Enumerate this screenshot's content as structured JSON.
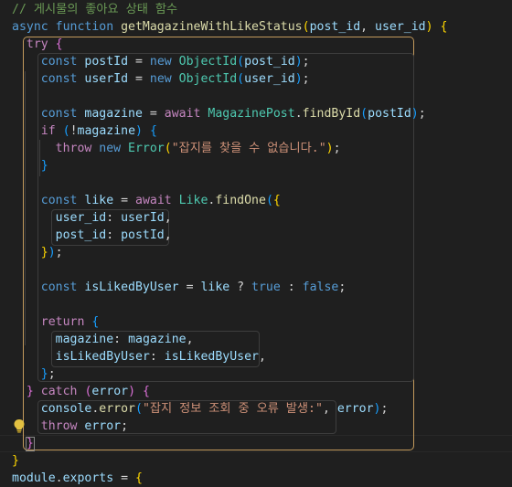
{
  "editor": {
    "lightbulb_icon": "lightbulb-icon",
    "lines": [
      {
        "n": 0,
        "tokens": [
          {
            "t": "// 게시물의 좋아요 상태 함수",
            "c": "cmt"
          }
        ]
      },
      {
        "n": 1,
        "tokens": [
          {
            "t": "async ",
            "c": "kw"
          },
          {
            "t": "function ",
            "c": "kw"
          },
          {
            "t": "getMagazineWithLikeStatus",
            "c": "fn"
          },
          {
            "t": "(",
            "c": "b1"
          },
          {
            "t": "post_id",
            "c": "var"
          },
          {
            "t": ", ",
            "c": "plain"
          },
          {
            "t": "user_id",
            "c": "var"
          },
          {
            "t": ")",
            "c": "b1"
          },
          {
            "t": " ",
            "c": "plain"
          },
          {
            "t": "{",
            "c": "b1"
          }
        ]
      },
      {
        "n": 2,
        "tokens": [
          {
            "t": "  ",
            "c": "plain"
          },
          {
            "t": "try",
            "c": "ctl"
          },
          {
            "t": " ",
            "c": "plain"
          },
          {
            "t": "{",
            "c": "b2"
          }
        ]
      },
      {
        "n": 3,
        "tokens": [
          {
            "t": "    ",
            "c": "plain"
          },
          {
            "t": "const ",
            "c": "kw"
          },
          {
            "t": "postId",
            "c": "var"
          },
          {
            "t": " = ",
            "c": "plain"
          },
          {
            "t": "new ",
            "c": "kw"
          },
          {
            "t": "ObjectId",
            "c": "cls"
          },
          {
            "t": "(",
            "c": "b3"
          },
          {
            "t": "post_id",
            "c": "var"
          },
          {
            "t": ")",
            "c": "b3"
          },
          {
            "t": ";",
            "c": "plain"
          }
        ]
      },
      {
        "n": 4,
        "tokens": [
          {
            "t": "    ",
            "c": "plain"
          },
          {
            "t": "const ",
            "c": "kw"
          },
          {
            "t": "userId",
            "c": "var"
          },
          {
            "t": " = ",
            "c": "plain"
          },
          {
            "t": "new ",
            "c": "kw"
          },
          {
            "t": "ObjectId",
            "c": "cls"
          },
          {
            "t": "(",
            "c": "b3"
          },
          {
            "t": "user_id",
            "c": "var"
          },
          {
            "t": ")",
            "c": "b3"
          },
          {
            "t": ";",
            "c": "plain"
          }
        ]
      },
      {
        "n": 5,
        "tokens": []
      },
      {
        "n": 6,
        "tokens": [
          {
            "t": "    ",
            "c": "plain"
          },
          {
            "t": "const ",
            "c": "kw"
          },
          {
            "t": "magazine",
            "c": "var"
          },
          {
            "t": " = ",
            "c": "plain"
          },
          {
            "t": "await ",
            "c": "ctl"
          },
          {
            "t": "MagazinePost",
            "c": "cls"
          },
          {
            "t": ".",
            "c": "plain"
          },
          {
            "t": "findById",
            "c": "fn"
          },
          {
            "t": "(",
            "c": "b3"
          },
          {
            "t": "postId",
            "c": "var"
          },
          {
            "t": ")",
            "c": "b3"
          },
          {
            "t": ";",
            "c": "plain"
          }
        ]
      },
      {
        "n": 7,
        "tokens": [
          {
            "t": "    ",
            "c": "plain"
          },
          {
            "t": "if",
            "c": "ctl"
          },
          {
            "t": " ",
            "c": "plain"
          },
          {
            "t": "(",
            "c": "b3"
          },
          {
            "t": "!",
            "c": "plain"
          },
          {
            "t": "magazine",
            "c": "var"
          },
          {
            "t": ")",
            "c": "b3"
          },
          {
            "t": " ",
            "c": "plain"
          },
          {
            "t": "{",
            "c": "b3"
          }
        ]
      },
      {
        "n": 8,
        "tokens": [
          {
            "t": "      ",
            "c": "plain"
          },
          {
            "t": "throw ",
            "c": "ctl"
          },
          {
            "t": "new ",
            "c": "kw"
          },
          {
            "t": "Error",
            "c": "cls"
          },
          {
            "t": "(",
            "c": "b1"
          },
          {
            "t": "\"잡지를 찾을 수 없습니다.\"",
            "c": "str"
          },
          {
            "t": ")",
            "c": "b1"
          },
          {
            "t": ";",
            "c": "plain"
          }
        ]
      },
      {
        "n": 9,
        "tokens": [
          {
            "t": "    ",
            "c": "plain"
          },
          {
            "t": "}",
            "c": "b3"
          }
        ]
      },
      {
        "n": 10,
        "tokens": []
      },
      {
        "n": 11,
        "tokens": [
          {
            "t": "    ",
            "c": "plain"
          },
          {
            "t": "const ",
            "c": "kw"
          },
          {
            "t": "like",
            "c": "var"
          },
          {
            "t": " = ",
            "c": "plain"
          },
          {
            "t": "await ",
            "c": "ctl"
          },
          {
            "t": "Like",
            "c": "cls"
          },
          {
            "t": ".",
            "c": "plain"
          },
          {
            "t": "findOne",
            "c": "fn"
          },
          {
            "t": "(",
            "c": "b3"
          },
          {
            "t": "{",
            "c": "b1"
          }
        ]
      },
      {
        "n": 12,
        "tokens": [
          {
            "t": "      ",
            "c": "plain"
          },
          {
            "t": "user_id",
            "c": "var"
          },
          {
            "t": ": ",
            "c": "plain"
          },
          {
            "t": "userId",
            "c": "var"
          },
          {
            "t": ",",
            "c": "plain"
          }
        ]
      },
      {
        "n": 13,
        "tokens": [
          {
            "t": "      ",
            "c": "plain"
          },
          {
            "t": "post_id",
            "c": "var"
          },
          {
            "t": ": ",
            "c": "plain"
          },
          {
            "t": "postId",
            "c": "var"
          },
          {
            "t": ",",
            "c": "plain"
          }
        ]
      },
      {
        "n": 14,
        "tokens": [
          {
            "t": "    ",
            "c": "plain"
          },
          {
            "t": "}",
            "c": "b1"
          },
          {
            "t": ")",
            "c": "b3"
          },
          {
            "t": ";",
            "c": "plain"
          }
        ]
      },
      {
        "n": 15,
        "tokens": []
      },
      {
        "n": 16,
        "tokens": [
          {
            "t": "    ",
            "c": "plain"
          },
          {
            "t": "const ",
            "c": "kw"
          },
          {
            "t": "isLikedByUser",
            "c": "var"
          },
          {
            "t": " = ",
            "c": "plain"
          },
          {
            "t": "like",
            "c": "var"
          },
          {
            "t": " ? ",
            "c": "plain"
          },
          {
            "t": "true",
            "c": "kw"
          },
          {
            "t": " : ",
            "c": "plain"
          },
          {
            "t": "false",
            "c": "kw"
          },
          {
            "t": ";",
            "c": "plain"
          }
        ]
      },
      {
        "n": 17,
        "tokens": []
      },
      {
        "n": 18,
        "tokens": [
          {
            "t": "    ",
            "c": "plain"
          },
          {
            "t": "return",
            "c": "ctl"
          },
          {
            "t": " ",
            "c": "plain"
          },
          {
            "t": "{",
            "c": "b3"
          }
        ]
      },
      {
        "n": 19,
        "tokens": [
          {
            "t": "      ",
            "c": "plain"
          },
          {
            "t": "magazine",
            "c": "var"
          },
          {
            "t": ": ",
            "c": "plain"
          },
          {
            "t": "magazine",
            "c": "var"
          },
          {
            "t": ",",
            "c": "plain"
          }
        ]
      },
      {
        "n": 20,
        "tokens": [
          {
            "t": "      ",
            "c": "plain"
          },
          {
            "t": "isLikedByUser",
            "c": "var"
          },
          {
            "t": ": ",
            "c": "plain"
          },
          {
            "t": "isLikedByUser",
            "c": "var"
          },
          {
            "t": ",",
            "c": "plain"
          }
        ]
      },
      {
        "n": 21,
        "tokens": [
          {
            "t": "    ",
            "c": "plain"
          },
          {
            "t": "}",
            "c": "b3"
          },
          {
            "t": ";",
            "c": "plain"
          }
        ]
      },
      {
        "n": 22,
        "tokens": [
          {
            "t": "  ",
            "c": "plain"
          },
          {
            "t": "}",
            "c": "b2"
          },
          {
            "t": " ",
            "c": "plain"
          },
          {
            "t": "catch",
            "c": "ctl"
          },
          {
            "t": " ",
            "c": "plain"
          },
          {
            "t": "(",
            "c": "b2"
          },
          {
            "t": "error",
            "c": "var"
          },
          {
            "t": ")",
            "c": "b2"
          },
          {
            "t": " ",
            "c": "plain"
          },
          {
            "t": "{",
            "c": "b2"
          }
        ]
      },
      {
        "n": 23,
        "tokens": [
          {
            "t": "    ",
            "c": "plain"
          },
          {
            "t": "console",
            "c": "var"
          },
          {
            "t": ".",
            "c": "plain"
          },
          {
            "t": "error",
            "c": "fn"
          },
          {
            "t": "(",
            "c": "b3"
          },
          {
            "t": "\"잡지 정보 조회 중 오류 발생:\"",
            "c": "str"
          },
          {
            "t": ", ",
            "c": "plain"
          },
          {
            "t": "error",
            "c": "var"
          },
          {
            "t": ")",
            "c": "b3"
          },
          {
            "t": ";",
            "c": "plain"
          }
        ]
      },
      {
        "n": 24,
        "tokens": [
          {
            "t": "    ",
            "c": "plain"
          },
          {
            "t": "throw ",
            "c": "ctl"
          },
          {
            "t": "error",
            "c": "var"
          },
          {
            "t": ";",
            "c": "plain"
          }
        ]
      },
      {
        "n": 25,
        "tokens": [
          {
            "t": "  ",
            "c": "plain"
          },
          {
            "t": "}",
            "c": "b2"
          }
        ]
      },
      {
        "n": 26,
        "tokens": [
          {
            "t": "}",
            "c": "b1"
          }
        ]
      },
      {
        "n": 27,
        "tokens": [
          {
            "t": "module",
            "c": "var"
          },
          {
            "t": ".",
            "c": "plain"
          },
          {
            "t": "exports",
            "c": "var"
          },
          {
            "t": " = ",
            "c": "plain"
          },
          {
            "t": "{",
            "c": "b1"
          }
        ]
      }
    ]
  },
  "colors": {
    "background": "#1f1f1f",
    "keyword": "#569cd6",
    "control": "#c586c0",
    "function": "#dcdcaa",
    "variable": "#9cdcfe",
    "class": "#4ec9b0",
    "string": "#ce9178",
    "comment": "#6a9955",
    "block_outline": "#c29a5c"
  }
}
